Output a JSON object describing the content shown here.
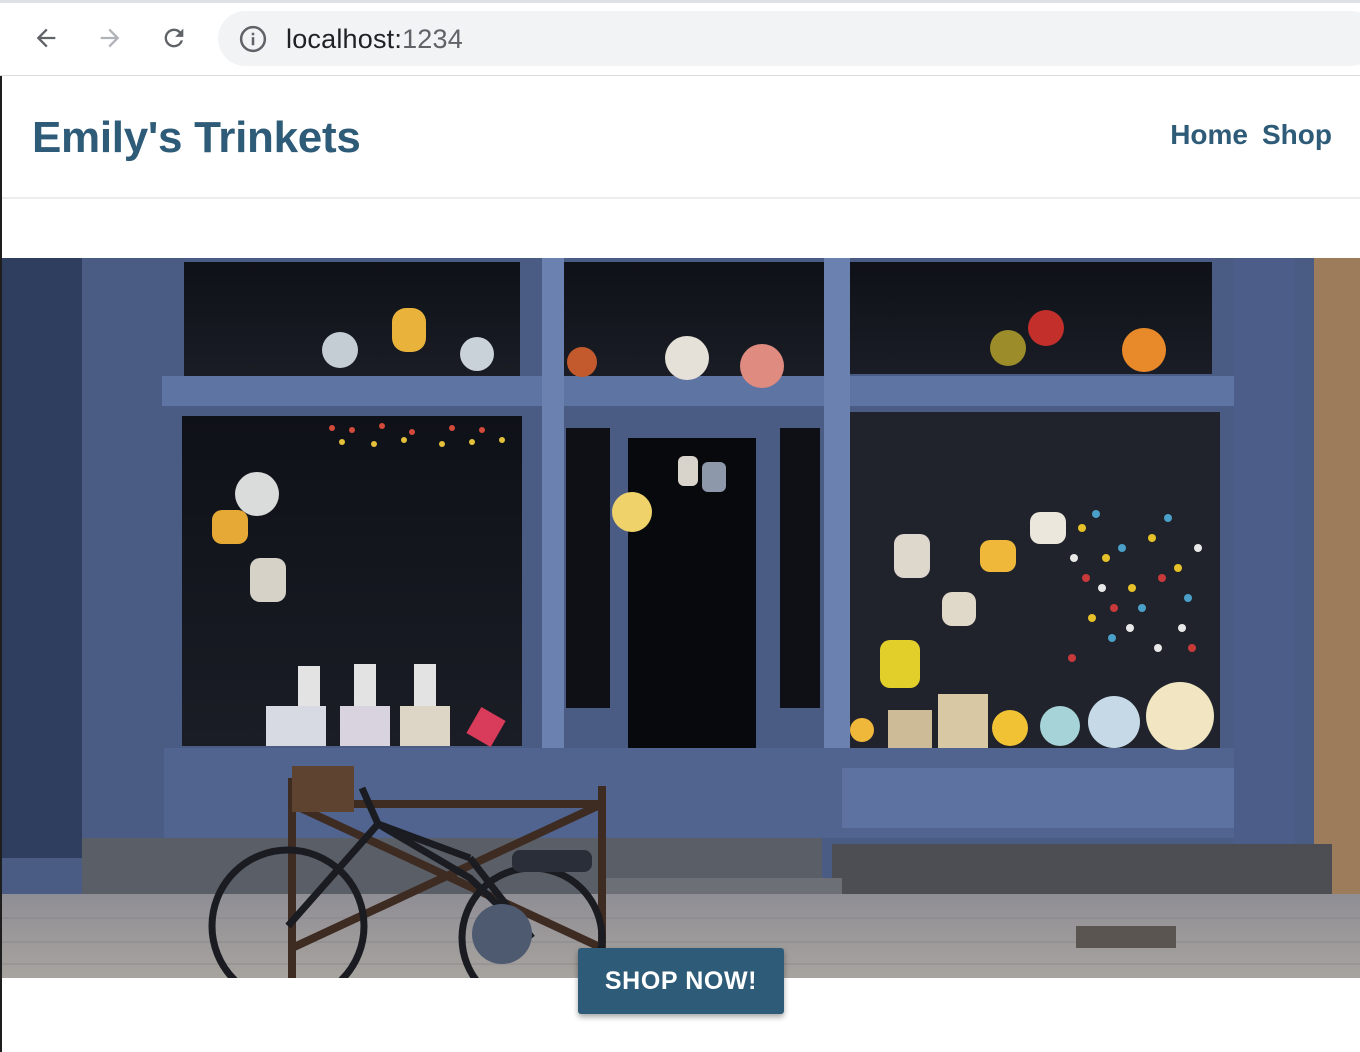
{
  "browser": {
    "url_host": "localhost:",
    "url_port": "1234"
  },
  "site": {
    "brand": "Emily's Trinkets",
    "nav": [
      {
        "label": "Home"
      },
      {
        "label": "Shop"
      }
    ]
  },
  "hero": {
    "image": "storefront-photo",
    "cta_label": "SHOP NOW!"
  },
  "colors": {
    "brand": "#2e5b78",
    "cta_background": "#2e5b78",
    "cta_text": "#ffffff"
  },
  "icons": [
    "back-arrow-icon",
    "forward-arrow-icon",
    "reload-icon",
    "info-icon"
  ]
}
